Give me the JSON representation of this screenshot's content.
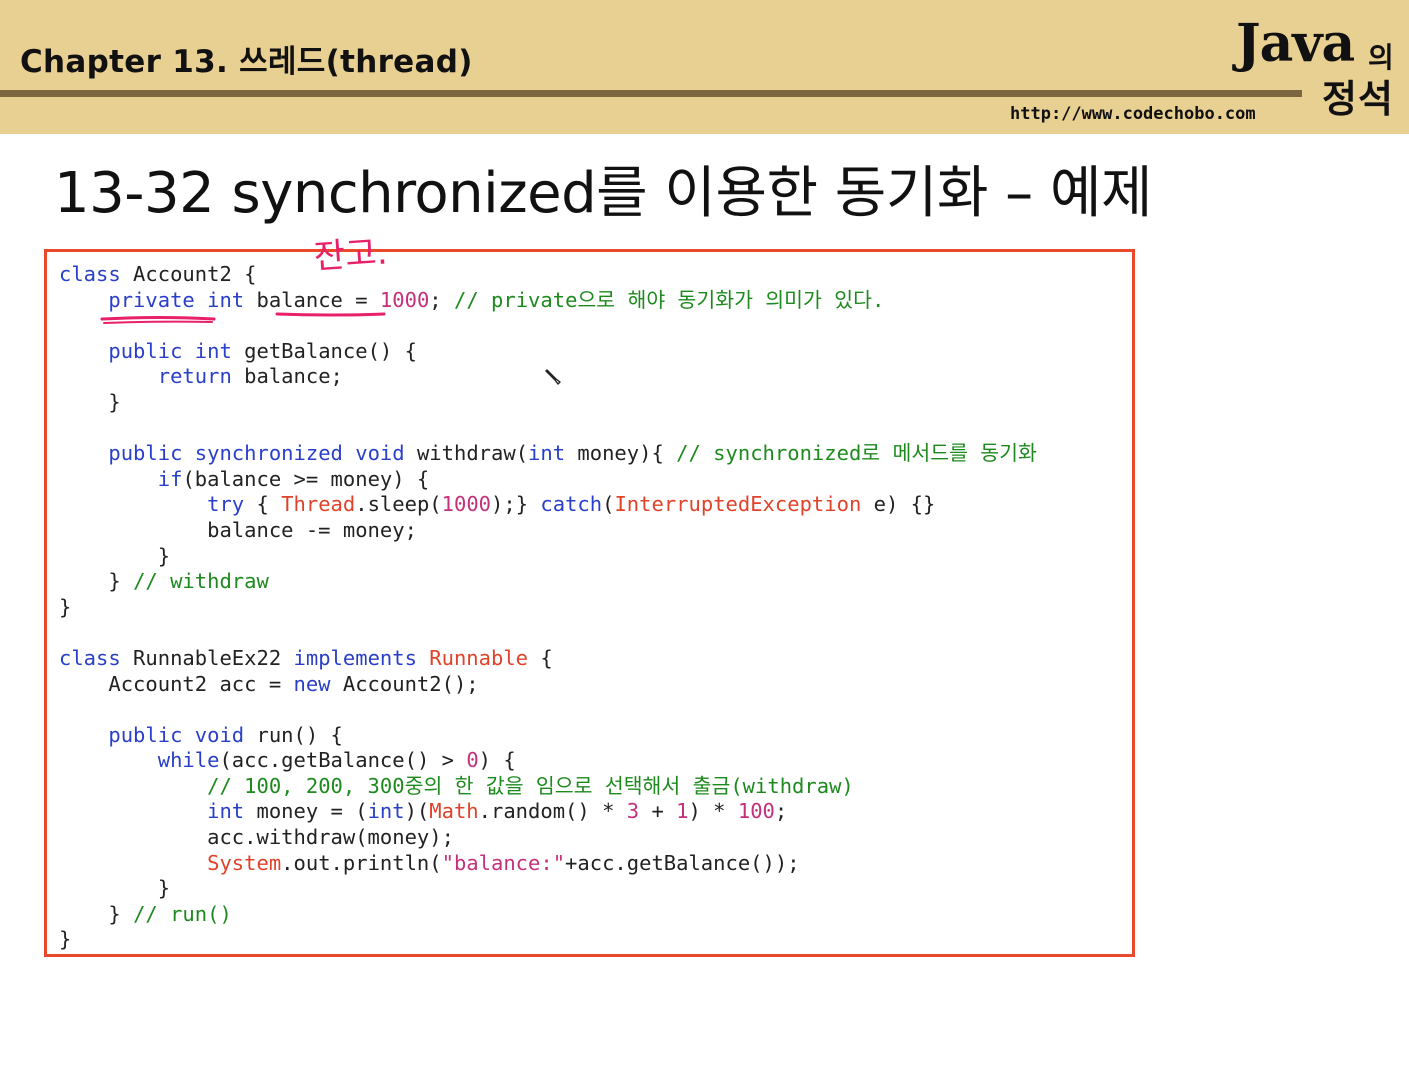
{
  "header": {
    "chapter_title": "Chapter 13. 쓰레드(thread)",
    "logo_main": "Java",
    "logo_particle": "의",
    "logo_sub": "정석",
    "url": "http://www.codechobo.com"
  },
  "slide": {
    "title": "13-32 synchronized를 이용한 동기화 – 예제"
  },
  "annotation": {
    "handwriting": "잔고."
  },
  "colors": {
    "header_bg": "#e8cf92",
    "header_rule": "#7d6740",
    "box_border": "#ea4a2c",
    "keyword": "#2a3fc9",
    "type": "#e0422a",
    "comment": "#1e8a1e",
    "number": "#c5307a",
    "pen": "#e8206a"
  },
  "code": [
    [
      {
        "t": "class",
        "c": "kw"
      },
      {
        "t": " Account2 {"
      }
    ],
    [
      {
        "t": "    "
      },
      {
        "t": "private",
        "c": "kw"
      },
      {
        "t": " "
      },
      {
        "t": "int",
        "c": "kw"
      },
      {
        "t": " balance = "
      },
      {
        "t": "1000",
        "c": "nm"
      },
      {
        "t": "; "
      },
      {
        "t": "// private으로 해야 동기화가 의미가 있다.",
        "c": "cm"
      }
    ],
    [],
    [
      {
        "t": "    "
      },
      {
        "t": "public",
        "c": "kw"
      },
      {
        "t": " "
      },
      {
        "t": "int",
        "c": "kw"
      },
      {
        "t": " getBalance() {"
      }
    ],
    [
      {
        "t": "        "
      },
      {
        "t": "return",
        "c": "kw"
      },
      {
        "t": " balance;"
      }
    ],
    [
      {
        "t": "    }"
      }
    ],
    [],
    [
      {
        "t": "    "
      },
      {
        "t": "public",
        "c": "kw"
      },
      {
        "t": " "
      },
      {
        "t": "synchronized",
        "c": "kw"
      },
      {
        "t": " "
      },
      {
        "t": "void",
        "c": "kw"
      },
      {
        "t": " withdraw("
      },
      {
        "t": "int",
        "c": "kw"
      },
      {
        "t": " money){ "
      },
      {
        "t": "// synchronized로 메서드를 동기화",
        "c": "cm"
      }
    ],
    [
      {
        "t": "        "
      },
      {
        "t": "if",
        "c": "kw"
      },
      {
        "t": "(balance >= money) {"
      }
    ],
    [
      {
        "t": "            "
      },
      {
        "t": "try",
        "c": "kw"
      },
      {
        "t": " { "
      },
      {
        "t": "Thread",
        "c": "ty"
      },
      {
        "t": ".sleep("
      },
      {
        "t": "1000",
        "c": "nm"
      },
      {
        "t": ");} "
      },
      {
        "t": "catch",
        "c": "kw"
      },
      {
        "t": "("
      },
      {
        "t": "InterruptedException",
        "c": "ty"
      },
      {
        "t": " e) {}"
      }
    ],
    [
      {
        "t": "            balance -= money;"
      }
    ],
    [
      {
        "t": "        }"
      }
    ],
    [
      {
        "t": "    } "
      },
      {
        "t": "// withdraw",
        "c": "cm"
      }
    ],
    [
      {
        "t": "}"
      }
    ],
    [],
    [
      {
        "t": "class",
        "c": "kw"
      },
      {
        "t": " RunnableEx22 "
      },
      {
        "t": "implements",
        "c": "kw"
      },
      {
        "t": " "
      },
      {
        "t": "Runnable",
        "c": "ty"
      },
      {
        "t": " {"
      }
    ],
    [
      {
        "t": "    Account2 acc = "
      },
      {
        "t": "new",
        "c": "kw"
      },
      {
        "t": " Account2();"
      }
    ],
    [],
    [
      {
        "t": "    "
      },
      {
        "t": "public",
        "c": "kw"
      },
      {
        "t": " "
      },
      {
        "t": "void",
        "c": "kw"
      },
      {
        "t": " run() {"
      }
    ],
    [
      {
        "t": "        "
      },
      {
        "t": "while",
        "c": "kw"
      },
      {
        "t": "(acc.getBalance() > "
      },
      {
        "t": "0",
        "c": "nm"
      },
      {
        "t": ") {"
      }
    ],
    [
      {
        "t": "            "
      },
      {
        "t": "// 100, 200, 300중의 한 값을 임으로 선택해서 출금(withdraw)",
        "c": "cm"
      }
    ],
    [
      {
        "t": "            "
      },
      {
        "t": "int",
        "c": "kw"
      },
      {
        "t": " money = ("
      },
      {
        "t": "int",
        "c": "kw"
      },
      {
        "t": ")("
      },
      {
        "t": "Math",
        "c": "ty"
      },
      {
        "t": ".random() * "
      },
      {
        "t": "3",
        "c": "nm"
      },
      {
        "t": " + "
      },
      {
        "t": "1",
        "c": "nm"
      },
      {
        "t": ") * "
      },
      {
        "t": "100",
        "c": "nm"
      },
      {
        "t": ";"
      }
    ],
    [
      {
        "t": "            acc.withdraw(money);"
      }
    ],
    [
      {
        "t": "            "
      },
      {
        "t": "System",
        "c": "ty"
      },
      {
        "t": ".out.println("
      },
      {
        "t": "\"balance:\"",
        "c": "st"
      },
      {
        "t": "+acc.getBalance());"
      }
    ],
    [
      {
        "t": "        }"
      }
    ],
    [
      {
        "t": "    } "
      },
      {
        "t": "// run()",
        "c": "cm"
      }
    ],
    [
      {
        "t": "}"
      }
    ]
  ]
}
